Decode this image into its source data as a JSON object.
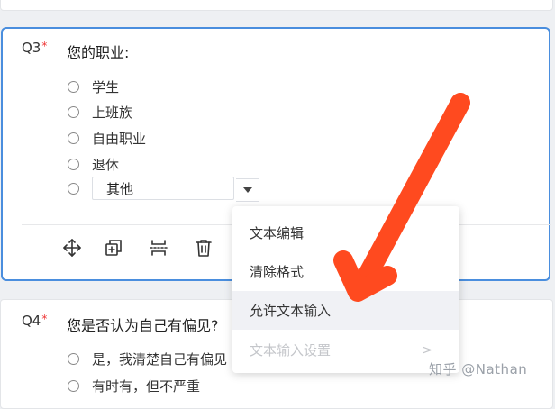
{
  "q3": {
    "number": "Q3",
    "required_mark": "*",
    "title": "您的职业:",
    "options": [
      "学生",
      "上班族",
      "自由职业",
      "退休"
    ],
    "other_value": "其他"
  },
  "toolbar": {
    "move_icon": "move-icon",
    "copy_icon": "copy-icon",
    "split_icon": "split-icon",
    "delete_icon": "delete-icon"
  },
  "menu": {
    "items": [
      "文本编辑",
      "清除格式",
      "允许文本输入",
      "文本输入设置"
    ]
  },
  "q4": {
    "number": "Q4",
    "required_mark": "*",
    "title": "您是否认为自己有偏见?",
    "options": [
      "是，我清楚自己有偏见",
      "有时有，但不严重"
    ]
  },
  "watermark": "知乎 @Nathan",
  "colors": {
    "accent": "#4a8ede",
    "arrow": "#ff4a1f",
    "required": "#e33333"
  }
}
